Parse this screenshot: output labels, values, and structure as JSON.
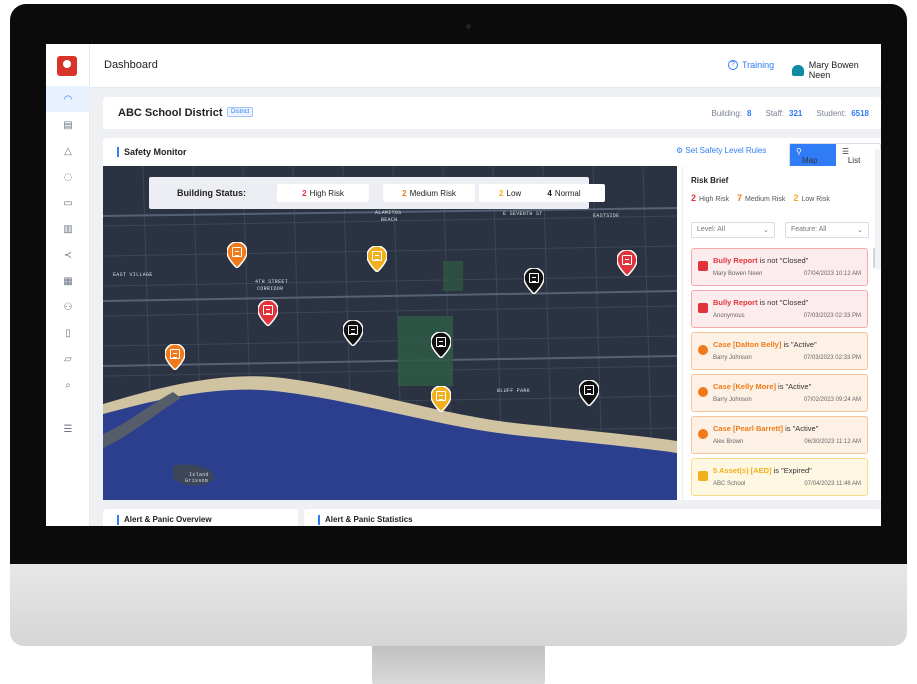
{
  "app": {
    "page_title": "Dashboard",
    "training": "Training",
    "user_name": "Mary Bowen Neen"
  },
  "district": {
    "name": "ABC School District",
    "tag": "District",
    "building_label": "Building:",
    "building_value": "8",
    "staff_label": "Staff:",
    "staff_value": "321",
    "student_label": "Student:",
    "student_value": "6518"
  },
  "monitor": {
    "title": "Safety Monitor",
    "rules_link": "Set Safety Level Rules",
    "map_label": "Map",
    "list_label": "List",
    "status": {
      "label": "Building Status:",
      "items": [
        {
          "count": "2",
          "label": "High Risk",
          "color": "#e0343c"
        },
        {
          "count": "2",
          "label": "Medium Risk",
          "color": "#f07a1a"
        },
        {
          "count": "2",
          "label": "Low Risk",
          "color": "#f2b01e"
        },
        {
          "count": "4",
          "label": "Normal",
          "color": "#111111"
        }
      ]
    },
    "map_labels": {
      "l1": "EAST VILLAGE",
      "l2": "4TH STREET",
      "l3": "CORRIDOR",
      "l4": "ALAMITOS",
      "l5": "BEACH",
      "l6": "EASTSIDE",
      "l7": "BLUFF PARK",
      "l8": "Island",
      "l9": "Grissom",
      "l10": "E SEVENTH ST"
    }
  },
  "brief": {
    "title": "Risk Brief",
    "counts": [
      {
        "count": "2",
        "label": "High Risk",
        "color": "#e0343c"
      },
      {
        "count": "7",
        "label": "Medium Risk",
        "color": "#f07a1a"
      },
      {
        "count": "2",
        "label": "Low Risk",
        "color": "#f2b01e"
      }
    ],
    "level_filter": "Level: All",
    "feature_filter": "Feature: All",
    "alerts": [
      {
        "title_bold": "Bully Report",
        "title_rest": " is not \"Closed\"",
        "who": "Mary Bowen Neen",
        "when": "07/04/2023 10:12 AM",
        "level": "high"
      },
      {
        "title_bold": "Bully Report",
        "title_rest": " is not \"Closed\"",
        "who": "Anonymous",
        "when": "07/03/2023 02:33 PM",
        "level": "high"
      },
      {
        "title_bold": "Case [Dalton Belly]",
        "title_rest": " is \"Active\"",
        "who": "Barry Johnson",
        "when": "07/03/2023 02:33 PM",
        "level": "medium"
      },
      {
        "title_bold": "Case [Kelly More]",
        "title_rest": " is \"Active\"",
        "who": "Barry Johnson",
        "when": "07/02/2023 09:24 AM",
        "level": "medium"
      },
      {
        "title_bold": "Case [Pearl Barrett]",
        "title_rest": " is \"Active\"",
        "who": "Alex Brown",
        "when": "06/30/2023 11:12 AM",
        "level": "medium"
      },
      {
        "title_bold": "5 Asset(s) [AED]",
        "title_rest": " is \"Expired\"",
        "who": "ABC School",
        "when": "07/04/2023 11:46 AM",
        "level": "low"
      }
    ]
  },
  "sections": {
    "alert_overview": "Alert & Panic Overview",
    "alert_stats": "Alert & Panic Statistics"
  },
  "colors": {
    "accent": "#2f7cf6",
    "high": "#e0343c",
    "medium": "#f07a1a",
    "low": "#f2b01e",
    "normal": "#111111"
  },
  "icons": [
    "gauge-icon",
    "map-icon",
    "bell-icon",
    "chat-icon",
    "briefcase-icon",
    "document-icon",
    "share-icon",
    "chart-icon",
    "people-icon",
    "file-icon",
    "folder-icon",
    "search-icon",
    "menu-icon"
  ]
}
